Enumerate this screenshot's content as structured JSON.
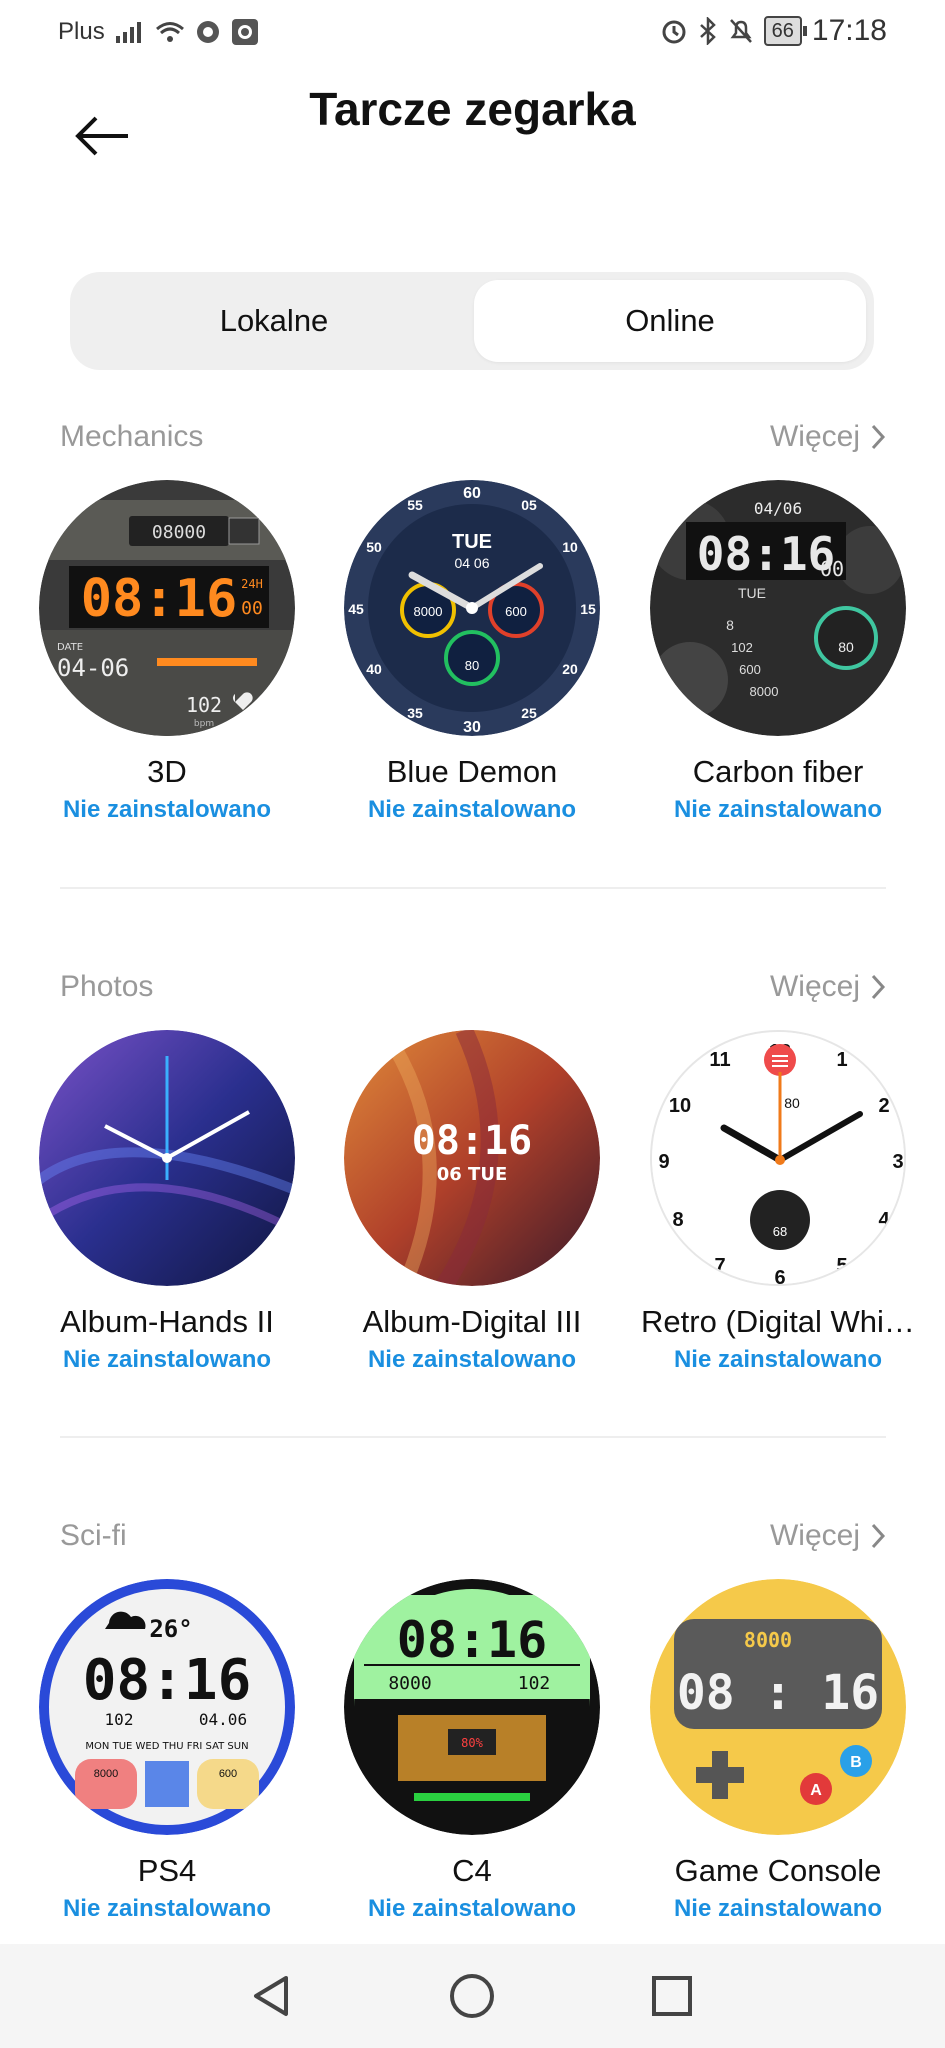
{
  "status_bar": {
    "carrier": "Plus",
    "battery": "66",
    "time": "17:18"
  },
  "header": {
    "title": "Tarcze zegarka"
  },
  "tabs": [
    {
      "label": "Lokalne",
      "selected": false
    },
    {
      "label": "Online",
      "selected": true
    }
  ],
  "more_label": "Więcej",
  "sections": [
    {
      "title": "Mechanics",
      "items": [
        {
          "name": "3D",
          "status": "Nie zainstalowano"
        },
        {
          "name": "Blue Demon",
          "status": "Nie zainstalowano"
        },
        {
          "name": "Carbon fiber",
          "status": "Nie zainstalowano"
        }
      ]
    },
    {
      "title": "Photos",
      "items": [
        {
          "name": "Album-Hands II",
          "status": "Nie zainstalowano"
        },
        {
          "name": "Album-Digital III",
          "status": "Nie zainstalowano"
        },
        {
          "name": "Retro (Digital Whi…",
          "status": "Nie zainstalowano"
        }
      ]
    },
    {
      "title": "Sci-fi",
      "items": [
        {
          "name": "PS4",
          "status": "Nie zainstalowano"
        },
        {
          "name": "C4",
          "status": "Nie zainstalowano"
        },
        {
          "name": "Game Console",
          "status": "Nie zainstalowano"
        }
      ]
    }
  ],
  "faces": {
    "d3": {
      "time": "08:16",
      "steps": "08000",
      "date_label": "DATE",
      "date": "04-06",
      "h24": "24H",
      "sec": "00",
      "bpm_value": "102",
      "bpm": "bpm"
    },
    "blue_demon": {
      "day": "TUE",
      "date": "04 06",
      "steps": "8000",
      "cal": "600",
      "bat": "80",
      "n60": "60",
      "n05": "05",
      "n10": "10",
      "n15": "15",
      "n20": "20",
      "n25": "25",
      "n30": "30",
      "n35": "35",
      "n40": "40",
      "n45": "45",
      "n50": "50",
      "n55": "55"
    },
    "carbon": {
      "date": "04/06",
      "time": "08:16",
      "sec": "00",
      "day": "TUE",
      "v8": "8",
      "hr": "102",
      "cal": "600",
      "steps": "8000",
      "bat": "80"
    },
    "album_digital": {
      "time": "08:16",
      "date": "06 TUE"
    },
    "retro": {
      "n12": "12",
      "n1": "1",
      "n2": "2",
      "n3": "3",
      "n4": "4",
      "n5": "5",
      "n6": "6",
      "n7": "7",
      "n8": "8",
      "n9": "9",
      "n10": "10",
      "n11": "11",
      "bat": "80",
      "hr": "68"
    },
    "ps4": {
      "temp": "26°",
      "time": "08:16",
      "hr": "102",
      "date": "04.06",
      "days": "MON TUE WED THU FRI SAT SUN",
      "steps": "8000",
      "cal": "600"
    },
    "c4": {
      "time": "08:16",
      "steps": "8000",
      "hr": "102",
      "pct": "80%"
    },
    "game": {
      "steps": "8000",
      "time": "08 : 16",
      "a": "A",
      "b": "B"
    }
  },
  "colors": {
    "accent": "#1a8fe0",
    "muted": "#999999",
    "orange_lcd": "#ff8a1f",
    "c4_green": "#9ff2a0",
    "game_yellow": "#f5c94a"
  }
}
